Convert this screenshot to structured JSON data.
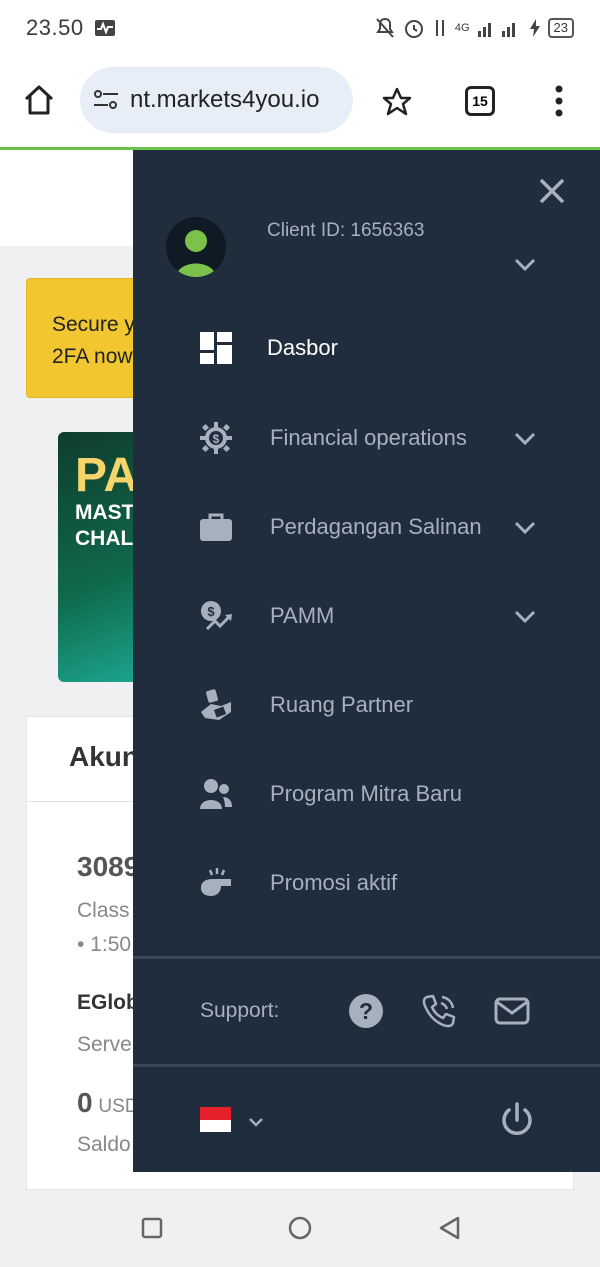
{
  "status_bar": {
    "time": "23.50",
    "network": "4G",
    "battery": "23"
  },
  "browser": {
    "url": "nt.markets4you.io",
    "tab_count": "15"
  },
  "background_page": {
    "alert_text_line1": "Secure y",
    "alert_text_line2": "2FA now",
    "promo_title": "PA",
    "promo_sub_line1": "MAST",
    "promo_sub_line2": "CHAL",
    "account_title": "Akun",
    "account_number": "3089",
    "account_type": "Class",
    "leverage": "• 1:50",
    "server_name": "EGlob",
    "server_label": "Serve",
    "balance_value": "0",
    "balance_currency": "USD",
    "balance_label": "Saldo"
  },
  "drawer": {
    "client_id": "Client ID: 1656363",
    "menu": [
      {
        "label": "Dasbor",
        "icon": "dashboard-icon",
        "active": true,
        "has_submenu": false
      },
      {
        "label": "Financial operations",
        "icon": "gear-dollar-icon",
        "active": false,
        "has_submenu": true
      },
      {
        "label": "Perdagangan Salinan",
        "icon": "briefcase-icon",
        "active": false,
        "has_submenu": true
      },
      {
        "label": "PAMM",
        "icon": "money-chart-icon",
        "active": false,
        "has_submenu": true
      },
      {
        "label": "Ruang Partner",
        "icon": "handshake-icon",
        "active": false,
        "has_submenu": false
      },
      {
        "label": "Program Mitra Baru",
        "icon": "users-icon",
        "active": false,
        "has_submenu": false
      },
      {
        "label": "Promosi aktif",
        "icon": "whistle-icon",
        "active": false,
        "has_submenu": false
      }
    ],
    "support_label": "Support:",
    "support_icons": [
      "help-icon",
      "phone-icon",
      "mail-icon"
    ],
    "language_flag": "indonesia-flag-icon"
  },
  "colors": {
    "drawer_bg": "#1f2d3d",
    "alert_bg": "#f1c631",
    "accent_green": "#6cc24a",
    "avatar_green": "#7cc24a"
  }
}
